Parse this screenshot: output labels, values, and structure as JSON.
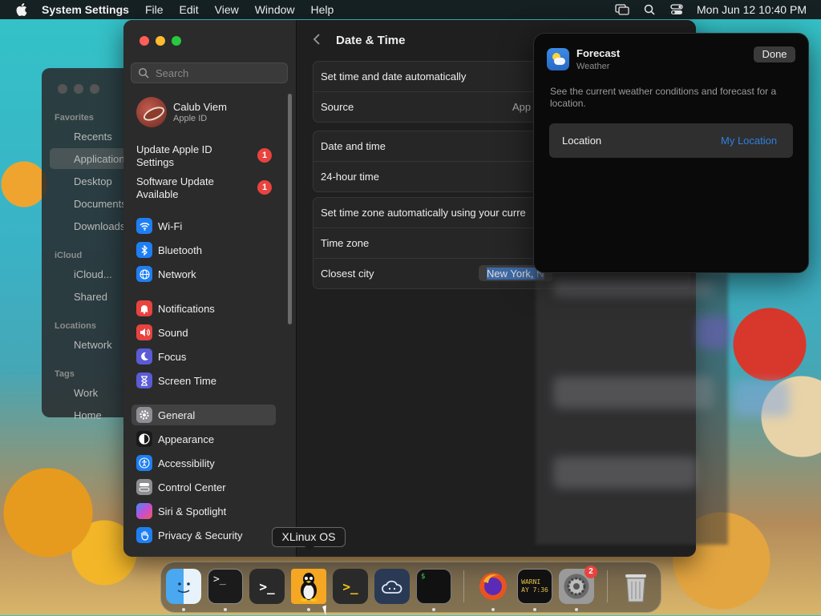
{
  "menubar": {
    "app": "System Settings",
    "items": [
      "File",
      "Edit",
      "View",
      "Window",
      "Help"
    ],
    "clock": "Mon Jun 12  10:40 PM"
  },
  "finder": {
    "sections": [
      "Favorites",
      "iCloud",
      "Locations",
      "Tags"
    ],
    "items": [
      "Recents",
      "Applications",
      "Desktop",
      "Documents",
      "Downloads",
      "iCloud...",
      "Shared",
      "Network",
      "Work",
      "Home"
    ]
  },
  "settings": {
    "search_placeholder": "Search",
    "user": {
      "name": "Calub Viem",
      "subtitle": "Apple ID"
    },
    "updates": [
      {
        "label": "Update Apple ID Settings",
        "count": "1"
      },
      {
        "label": "Software Update Available",
        "count": "1"
      }
    ],
    "sidebar": [
      {
        "label": "Wi-Fi",
        "icon": "wifi-icon",
        "color": "#1f7ff2"
      },
      {
        "label": "Bluetooth",
        "icon": "bluetooth-icon",
        "color": "#1f7ff2"
      },
      {
        "label": "Network",
        "icon": "globe-icon",
        "color": "#1f7ff2"
      },
      {
        "label": "Notifications",
        "icon": "bell-icon",
        "color": "#e8433f"
      },
      {
        "label": "Sound",
        "icon": "speaker-icon",
        "color": "#e8433f"
      },
      {
        "label": "Focus",
        "icon": "moon-icon",
        "color": "#5b5bd6"
      },
      {
        "label": "Screen Time",
        "icon": "hourglass-icon",
        "color": "#5b5bd6"
      },
      {
        "label": "General",
        "icon": "gear-icon",
        "color": "#8e8e93"
      },
      {
        "label": "Appearance",
        "icon": "appearance-icon",
        "color": "#1a1a1a"
      },
      {
        "label": "Accessibility",
        "icon": "accessibility-icon",
        "color": "#1f7ff2"
      },
      {
        "label": "Control Center",
        "icon": "control-center-icon",
        "color": "#8e8e93"
      },
      {
        "label": "Siri & Spotlight",
        "icon": "siri-icon",
        "color": "#c24fd6"
      },
      {
        "label": "Privacy & Security",
        "icon": "hand-icon",
        "color": "#1f7ff2"
      }
    ],
    "content": {
      "title": "Date & Time",
      "group1": [
        {
          "label": "Set time and date automatically"
        },
        {
          "label": "Source",
          "value": "App"
        }
      ],
      "group2": [
        {
          "label": "Date and time"
        },
        {
          "label": "24-hour time"
        }
      ],
      "group3": [
        {
          "label": "Set time zone automatically using your curre"
        },
        {
          "label": "Time zone"
        },
        {
          "label": "Closest city",
          "value": "New York, N"
        }
      ]
    }
  },
  "forecast": {
    "title": "Forecast",
    "subtitle": "Weather",
    "done": "Done",
    "description": "See the current weather conditions and forecast for a location.",
    "location_label": "Location",
    "location_value": "My Location"
  },
  "dock": {
    "tooltip": "XLinux OS",
    "settings_badge": "2",
    "warning_text": "WARNI\nAY 7:36"
  }
}
